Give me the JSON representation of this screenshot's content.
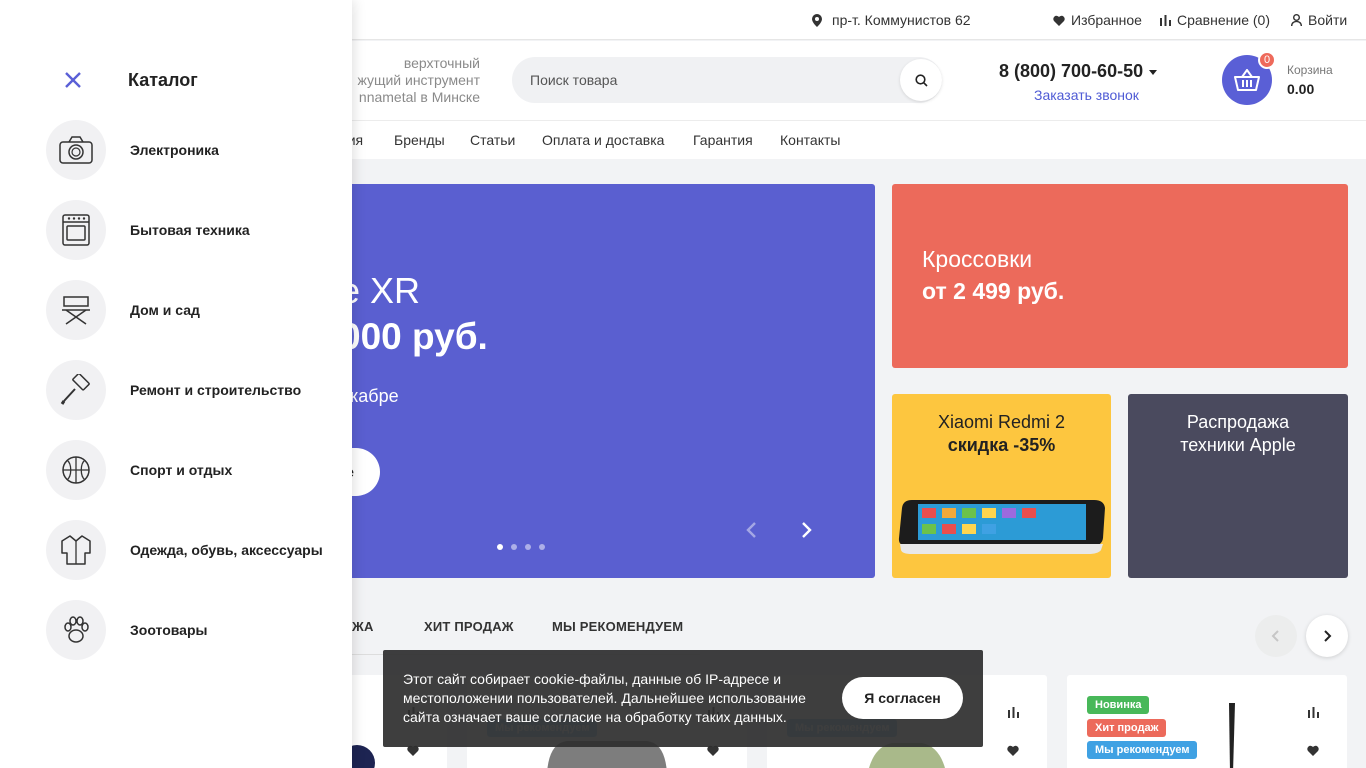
{
  "topbar": {
    "address": "пр-т. Коммунистов 62",
    "favorites": "Избранное",
    "compare": "Сравнение (0)",
    "login": "Войти"
  },
  "header": {
    "tagline": "верхточный\nжущий инструмент\nnnametal в Минске",
    "search_placeholder": "Поиск товара",
    "phone": "8 (800) 700-60-50",
    "callback": "Заказать звонок",
    "cart_count": "0",
    "cart_label": "Корзина",
    "cart_sum": "0.00"
  },
  "nav": [
    "ния",
    "Бренды",
    "Статьи",
    "Оплата и доставка",
    "Гарантия",
    "Контакты"
  ],
  "hero": {
    "title": "e XR",
    "price": "000 руб.",
    "subtitle": "екабре",
    "button": "е",
    "slide_active": 1,
    "slide_count": 4
  },
  "banners": {
    "sneakers_title": "Кроссовки",
    "sneakers_price": "от 2 499 руб.",
    "xiaomi_title": "Xiaomi Redmi 2",
    "xiaomi_discount": "скидка -35%",
    "apple_line1": "Распродажа",
    "apple_line2": "техники Apple"
  },
  "product_tabs": [
    "ЖА",
    "ХИТ ПРОДАЖ",
    "МЫ РЕКОМЕНДУЕМ"
  ],
  "product_badges": {
    "new": "Новинка",
    "hit": "Хит продаж",
    "rec": "Мы рекомендуем"
  },
  "cookie": {
    "text": "Этот сайт собирает cookie-файлы, данные об IP-адресе и местоположении пользователей. Дальнейшее использование сайта означает ваше согласие на обработку таких данных.",
    "button": "Я согласен"
  },
  "catalog": {
    "title": "Каталог",
    "items": [
      {
        "label": "Электроника",
        "icon": "camera-icon"
      },
      {
        "label": "Бытовая техника",
        "icon": "oven-icon"
      },
      {
        "label": "Дом и сад",
        "icon": "chair-icon"
      },
      {
        "label": "Ремонт и строительство",
        "icon": "paint-roller-icon"
      },
      {
        "label": "Спорт и отдых",
        "icon": "ball-icon"
      },
      {
        "label": "Одежда, обувь, аксессуары",
        "icon": "jacket-icon"
      },
      {
        "label": "Зоотовары",
        "icon": "paw-icon"
      }
    ]
  },
  "colors": {
    "accent": "#5a5fd6",
    "hero_bg": "#5a5fd0",
    "sneakers_bg": "#ec6a5b",
    "xiaomi_bg": "#fdc63f",
    "apple_bg": "#4a4a5e",
    "badge_new": "#48b859",
    "badge_hit": "#ec6a5b",
    "badge_rec": "#3fa1e3"
  }
}
